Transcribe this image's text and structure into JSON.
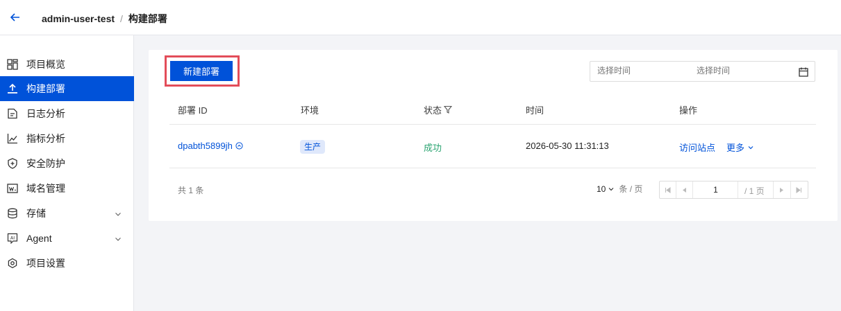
{
  "header": {
    "project": "admin-user-test",
    "separator": "/",
    "current": "构建部署"
  },
  "sidebar": {
    "items": [
      {
        "label": "项目概览",
        "icon": "dashboard-icon"
      },
      {
        "label": "构建部署",
        "icon": "upload-icon",
        "active": true
      },
      {
        "label": "日志分析",
        "icon": "log-icon"
      },
      {
        "label": "指标分析",
        "icon": "chart-line-icon"
      },
      {
        "label": "安全防护",
        "icon": "shield-icon"
      },
      {
        "label": "域名管理",
        "icon": "domain-icon"
      },
      {
        "label": "存储",
        "icon": "database-icon",
        "expandable": true
      },
      {
        "label": "Agent",
        "icon": "ai-icon",
        "expandable": true
      },
      {
        "label": "项目设置",
        "icon": "settings-icon"
      }
    ]
  },
  "toolbar": {
    "new_deploy_label": "新建部署",
    "date_start_placeholder": "选择时间",
    "date_end_placeholder": "选择时间"
  },
  "table": {
    "columns": [
      "部署 ID",
      "环境",
      "状态",
      "时间",
      "操作"
    ],
    "rows": [
      {
        "id": "dpabth5899jh",
        "env": "生产",
        "status": "成功",
        "time": "2026-05-30 11:31:13",
        "action_visit": "访问站点",
        "action_more": "更多"
      }
    ]
  },
  "pagination": {
    "total": "共 1 条",
    "page_size": "10",
    "page_size_unit": "条 / 页",
    "current_page": "1",
    "total_pages": "/ 1 页"
  },
  "colors": {
    "primary": "#0052d9",
    "success": "#2ba471",
    "highlight_border": "#e34d59"
  }
}
